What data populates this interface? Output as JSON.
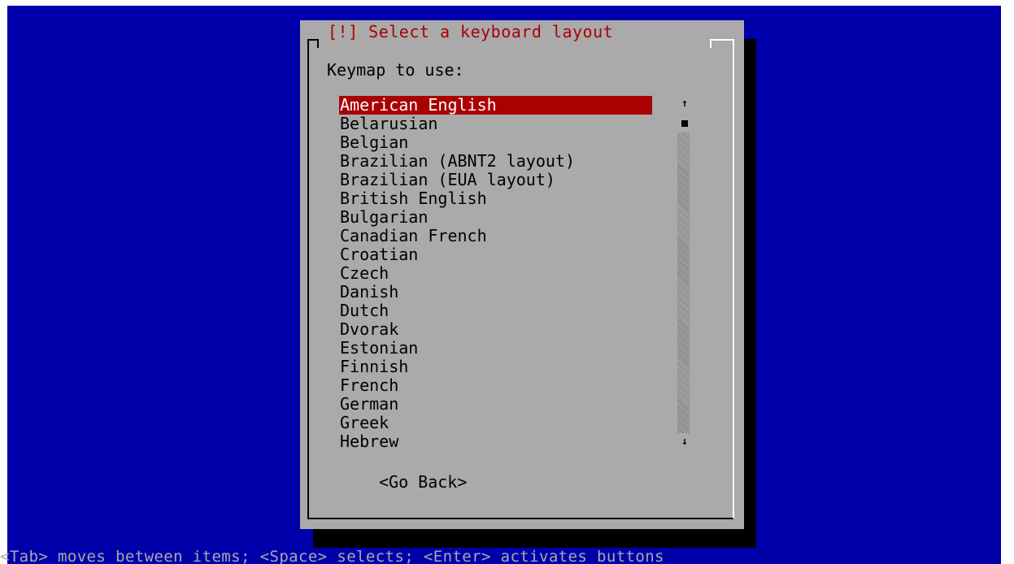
{
  "dialog": {
    "title": "[!] Select a keyboard layout",
    "prompt": "Keymap to use:",
    "go_back_label": "<Go Back>"
  },
  "keymaps": [
    "American English",
    "Belarusian",
    "Belgian",
    "Brazilian (ABNT2 layout)",
    "Brazilian (EUA layout)",
    "British English",
    "Bulgarian",
    "Canadian French",
    "Croatian",
    "Czech",
    "Danish",
    "Dutch",
    "Dvorak",
    "Estonian",
    "Finnish",
    "French",
    "German",
    "Greek",
    "Hebrew"
  ],
  "selected_keymap": "American English",
  "scrollbar": {
    "up_icon": "arrow-up-icon",
    "down_icon": "arrow-down-icon",
    "up_glyph": "↑",
    "down_glyph": "↓"
  },
  "help_line": "<Tab> moves between items; <Space> selects; <Enter> activates buttons",
  "colors": {
    "background": "#0000aa",
    "dialog": "#aaaaaa",
    "accent": "#aa0000",
    "shadow": "#000000",
    "help_text": "#aaaaaa"
  }
}
